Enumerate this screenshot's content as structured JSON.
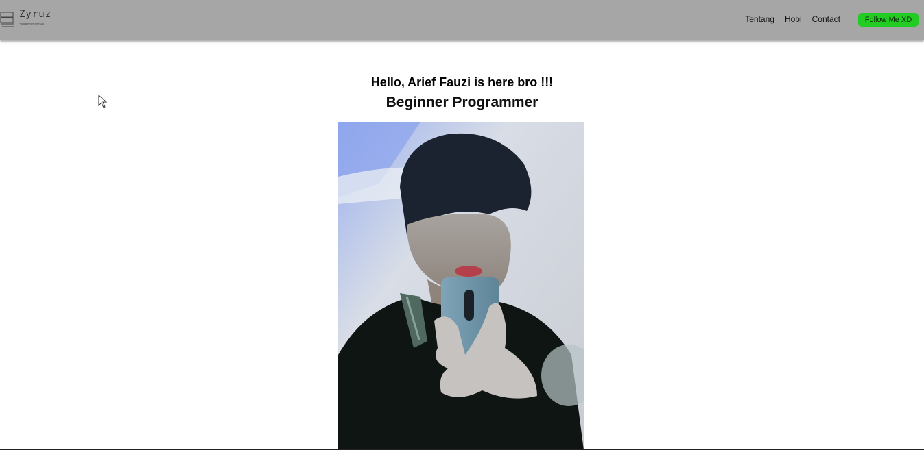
{
  "navbar": {
    "logo": {
      "text": "Zyruz",
      "subtext": "Programmer Pemula"
    },
    "links": [
      {
        "label": "Tentang"
      },
      {
        "label": "Hobi"
      },
      {
        "label": "Contact"
      }
    ],
    "follow_button": {
      "label": "Follow Me XD",
      "color": "#22cc22"
    },
    "background_color": "#a6a6a6"
  },
  "hero": {
    "greeting": "Hello, Arief Fauzi is here bro !!!",
    "title": "Beginner Programmer"
  },
  "photo": {
    "icon": "profile-photo"
  }
}
